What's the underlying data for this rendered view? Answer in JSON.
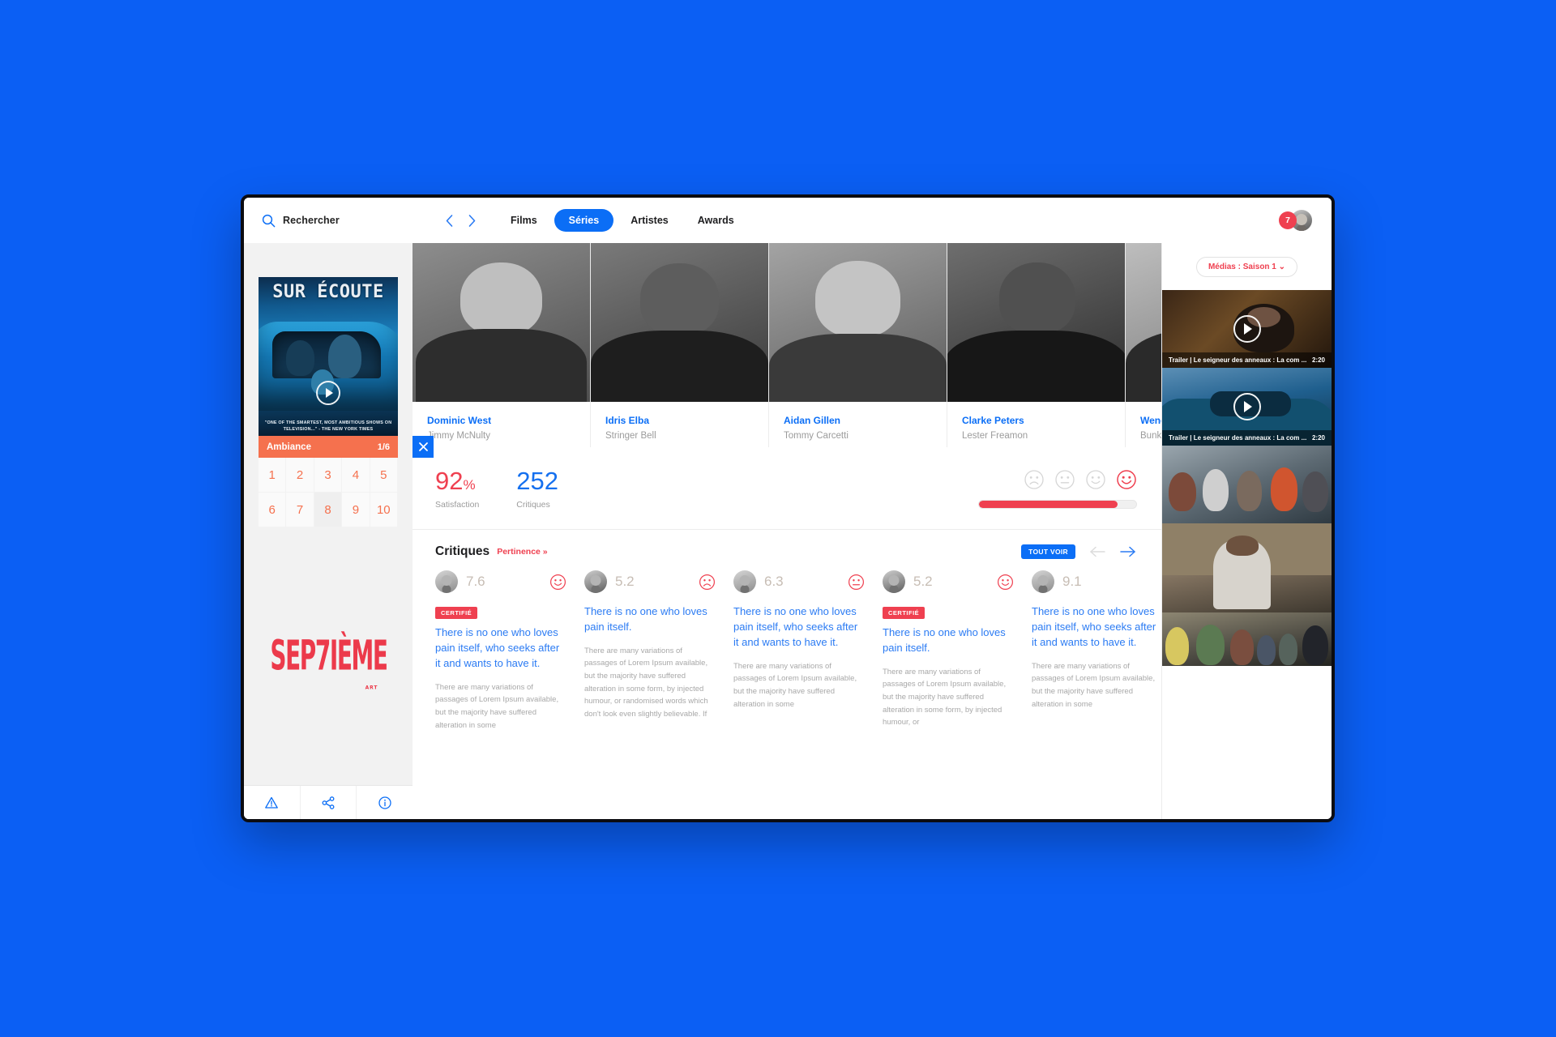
{
  "nav": {
    "search_placeholder": "Rechercher",
    "search_icon": "search-icon",
    "prev_icon": "chevron-left-icon",
    "next_icon": "chevron-right-icon",
    "tabs": [
      {
        "label": "Films",
        "active": false
      },
      {
        "label": "Séries",
        "active": true
      },
      {
        "label": "Artistes",
        "active": false
      },
      {
        "label": "Awards",
        "active": false
      }
    ],
    "notification_count": "7",
    "avatar_name": "user-avatar"
  },
  "sidebar": {
    "poster": {
      "title": "SUR ÉCOUTE",
      "quote": "\"ONE OF THE SMARTEST, MOST AMBITIOUS SHOWS ON TELEVISION...\" - THE NEW YORK TIMES",
      "play_icon": "play-icon"
    },
    "ambiance": {
      "label": "Ambiance",
      "count": "1/6",
      "close_icon": "close-icon"
    },
    "numbers": [
      "1",
      "2",
      "3",
      "4",
      "5",
      "6",
      "7",
      "8",
      "9",
      "10"
    ],
    "active_number": "8",
    "logo": {
      "text": "SEP7IÈME",
      "sub": "ART"
    },
    "icons": [
      {
        "name": "warning-icon"
      },
      {
        "name": "share-icon"
      },
      {
        "name": "info-icon"
      }
    ]
  },
  "cast": [
    {
      "name": "Dominic West",
      "role": "Jimmy McNulty"
    },
    {
      "name": "Idris Elba",
      "role": "Stringer Bell"
    },
    {
      "name": "Aidan Gillen",
      "role": "Tommy Carcetti"
    },
    {
      "name": "Clarke Peters",
      "role": "Lester Freamon"
    },
    {
      "name": "Wendell Pierce",
      "role": "Bunk Moreland"
    }
  ],
  "stats": {
    "satisfaction_value": "92",
    "satisfaction_unit": "%",
    "satisfaction_label": "Satisfaction",
    "critiques_value": "252",
    "critiques_label": "Critiques",
    "progress_percent": 88,
    "moods": [
      "sad-face-icon",
      "neutral-face-icon",
      "smile-face-icon",
      "happy-face-icon"
    ],
    "selected_mood": "happy-face-icon"
  },
  "critiques": {
    "title": "Critiques",
    "sort_label": "Pertinence »",
    "see_all_label": "TOUT VOIR",
    "prev_icon": "arrow-left-icon",
    "next_icon": "arrow-right-icon",
    "certified_label": "CERTIFIÉ",
    "cards": [
      {
        "score": "7.6",
        "face": "smile-face-icon",
        "certified": true,
        "quote": "There is no one who loves pain itself, who seeks after it and wants to have it.",
        "body": "There are many variations of passages of Lorem Ipsum available, but the majority have suffered alteration in some"
      },
      {
        "score": "5.2",
        "face": "sad-face-icon",
        "certified": false,
        "quote": "There is no one who loves pain itself.",
        "body": "There are many variations of passages of Lorem Ipsum available, but the majority have suffered alteration in some form, by injected humour, or randomised words which don't look even slightly believable. If"
      },
      {
        "score": "6.3",
        "face": "neutral-face-icon",
        "certified": false,
        "quote": "There is no one who loves pain itself, who seeks after it and wants to have it.",
        "body": "There are many variations of passages of Lorem Ipsum available, but the majority have suffered alteration in some"
      },
      {
        "score": "5.2",
        "face": "smile-face-icon",
        "certified": true,
        "quote": "There is no one who loves pain itself.",
        "body": "There are many variations of passages of Lorem Ipsum available, but the majority have suffered alteration in some form, by injected humour, or"
      },
      {
        "score": "9.1",
        "face": "smile-face-icon",
        "certified": false,
        "quote": "There is no one who loves pain itself, who seeks after it and wants to have it.",
        "body": "There are many variations of passages of Lorem Ipsum available, but the majority have suffered alteration in some"
      }
    ]
  },
  "media": {
    "pill_label": "Médias : Saison 1 ⌄",
    "items": [
      {
        "title": "Trailer | Le seigneur des anneaux : La com ...",
        "duration": "2:20",
        "has_play": true
      },
      {
        "title": "Trailer | Le seigneur des anneaux : La com ...",
        "duration": "2:20",
        "has_play": true
      },
      {
        "title": "",
        "duration": "",
        "has_play": false
      },
      {
        "title": "",
        "duration": "",
        "has_play": false
      },
      {
        "title": "",
        "duration": "",
        "has_play": false
      }
    ]
  }
}
